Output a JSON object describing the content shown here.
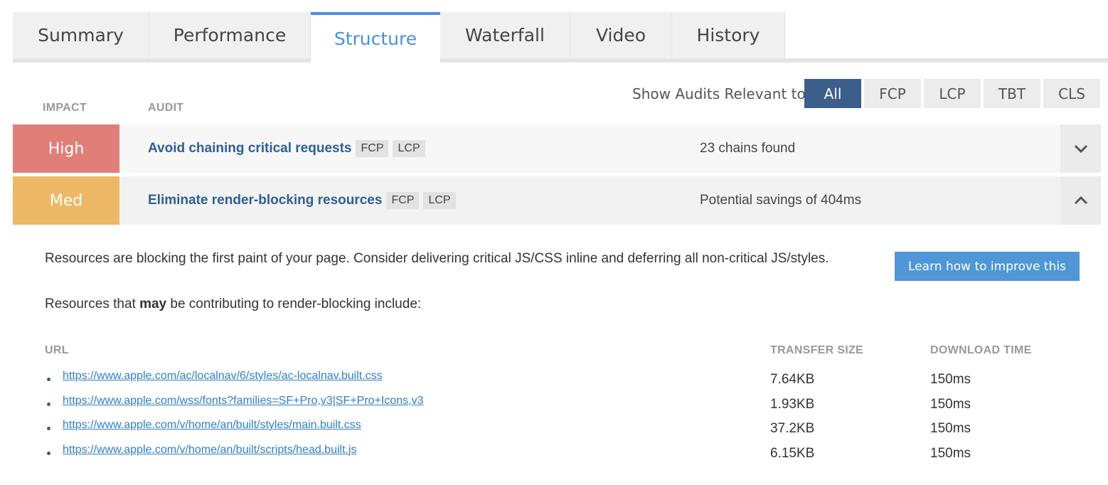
{
  "tabs": [
    {
      "label": "Summary",
      "active": false
    },
    {
      "label": "Performance",
      "active": false
    },
    {
      "label": "Structure",
      "active": true
    },
    {
      "label": "Waterfall",
      "active": false
    },
    {
      "label": "Video",
      "active": false
    },
    {
      "label": "History",
      "active": false
    }
  ],
  "headers": {
    "impact": "IMPACT",
    "audit": "AUDIT"
  },
  "filter": {
    "label": "Show Audits Relevant to",
    "options": [
      "All",
      "FCP",
      "LCP",
      "TBT",
      "CLS"
    ],
    "selected": "All"
  },
  "audits": [
    {
      "impact": "High",
      "impact_color": "#e07f78",
      "title": "Avoid chaining critical requests",
      "tags": [
        "FCP",
        "LCP"
      ],
      "result": "23 chains found",
      "expanded": false,
      "toggle_icon": "chevron-down-icon"
    },
    {
      "impact": "Med",
      "impact_color": "#ecb865",
      "title": "Eliminate render-blocking resources",
      "tags": [
        "FCP",
        "LCP"
      ],
      "result": "Potential savings of 404ms",
      "expanded": true,
      "toggle_icon": "chevron-up-icon"
    }
  ],
  "details": {
    "description": "Resources are blocking the first paint of your page. Consider delivering critical JS/CSS inline and deferring all non-critical JS/styles.",
    "intro_before": "Resources that ",
    "intro_bold": "may",
    "intro_after": " be contributing to render-blocking include:",
    "learn_button": "Learn how to improve this",
    "columns": {
      "url": "URL",
      "transfer_size": "TRANSFER SIZE",
      "download_time": "DOWNLOAD TIME"
    },
    "resources": [
      {
        "url": "https://www.apple.com/ac/localnav/6/styles/ac-localnav.built.css",
        "size": "7.64KB",
        "time": "150ms"
      },
      {
        "url": "https://www.apple.com/wss/fonts?families=SF+Pro,v3|SF+Pro+Icons,v3",
        "size": "1.93KB",
        "time": "150ms"
      },
      {
        "url": "https://www.apple.com/v/home/an/built/styles/main.built.css",
        "size": "37.2KB",
        "time": "150ms"
      },
      {
        "url": "https://www.apple.com/v/home/an/built/scripts/head.built.js",
        "size": "6.15KB",
        "time": "150ms"
      }
    ]
  },
  "colors": {
    "accent": "#4a90d9",
    "link": "#2e5f95",
    "filter_active": "#3b5f8a"
  }
}
